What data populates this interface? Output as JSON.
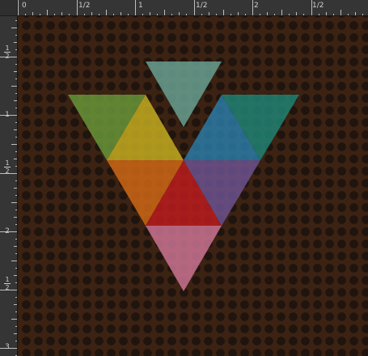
{
  "rulers": {
    "horizontal_labels": [
      "0",
      "1/2",
      "1",
      "1/2",
      "2",
      "1/2"
    ],
    "vertical_labels": [
      {
        "type": "fraction",
        "num": "1",
        "den": "2"
      },
      {
        "type": "text",
        "value": "1"
      },
      {
        "type": "fraction",
        "num": "1",
        "den": "2"
      },
      {
        "type": "text",
        "value": "2"
      },
      {
        "type": "fraction",
        "num": "1",
        "den": "2"
      },
      {
        "type": "text",
        "value": "3"
      }
    ]
  },
  "canvas": {
    "background_color": "#3b2212",
    "dot_color": "#1f140e"
  },
  "triangles": [
    {
      "name": "teal-top-triangle",
      "color": "#6aa596"
    },
    {
      "name": "green-triangle",
      "color": "#6a9a3a"
    },
    {
      "name": "yellow-triangle",
      "color": "#c9b121"
    },
    {
      "name": "blue-triangle",
      "color": "#2a7eab"
    },
    {
      "name": "dark-teal-triangle",
      "color": "#1f8678"
    },
    {
      "name": "orange-triangle",
      "color": "#d46a16"
    },
    {
      "name": "red-triangle",
      "color": "#bf1c1e"
    },
    {
      "name": "purple-triangle",
      "color": "#6e5493"
    },
    {
      "name": "pink-triangle",
      "color": "#d07797"
    }
  ]
}
